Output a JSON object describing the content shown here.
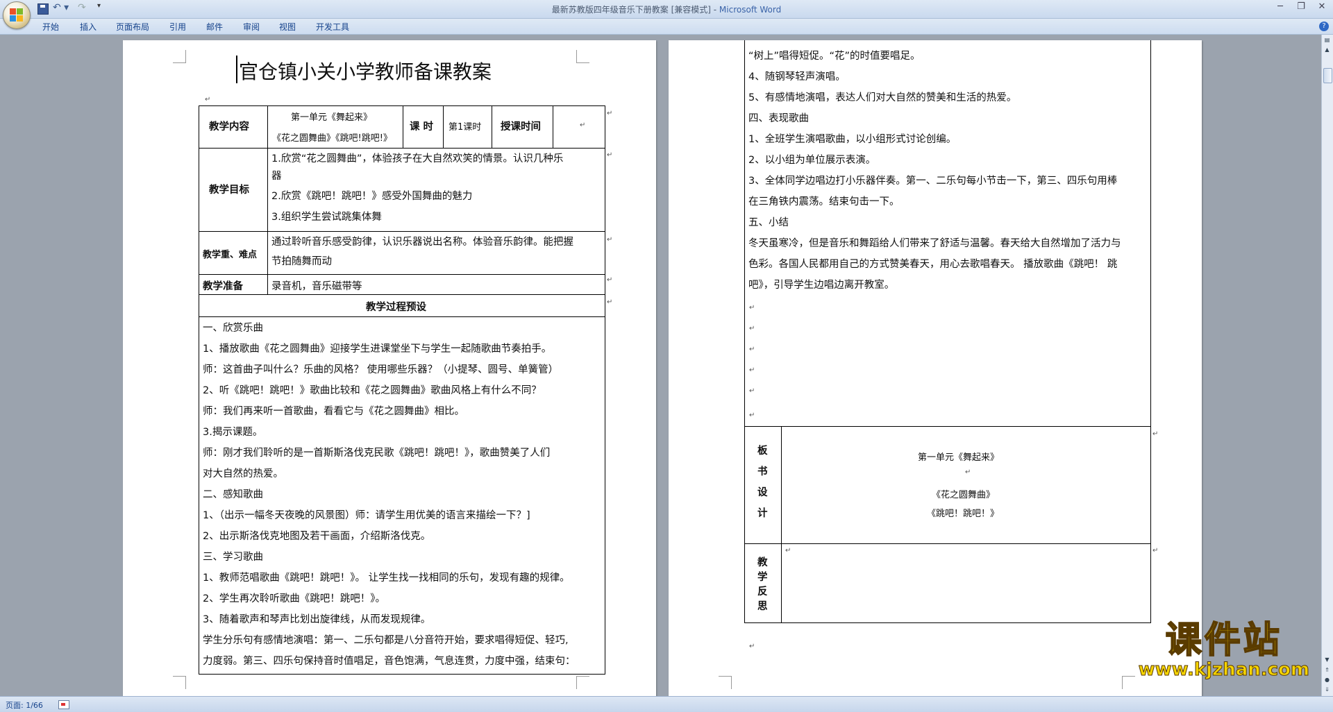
{
  "window": {
    "title": "最新苏教版四年级音乐下册教案 [兼容模式] - ",
    "app_name": "Microsoft Word",
    "qat_more": "▾",
    "minimize": "─",
    "restore": "❐",
    "close": "✕"
  },
  "ribbon": {
    "tabs": [
      "开始",
      "插入",
      "页面布局",
      "引用",
      "邮件",
      "审阅",
      "视图",
      "开发工具"
    ],
    "help": "?"
  },
  "statusbar": {
    "page": "页面: 1/66"
  },
  "page1": {
    "heading": "官仓镇小关小学教师备课教案",
    "table": {
      "content_label": "教学内容",
      "content_line1": "第一单元《舞起来》",
      "content_line2": "《花之圆舞曲》《跳吧!跳吧!》",
      "hours_label": "课 时",
      "hours_value": "第1课时",
      "time_label": "授课时间",
      "goals_label": "教学目标",
      "goals": [
        "1.欣赏“花之圆舞曲”，体验孩子在大自然欢笑的情景。认识几种乐",
        "器",
        "2.欣赏《跳吧！跳吧！》感受外国舞曲的魅力",
        "3.组织学生尝试跳集体舞"
      ],
      "key_label": "教学重、难点",
      "key": [
        "通过聆听音乐感受韵律，认识乐器说出名称。体验音乐韵律。能把握",
        "节拍随舞而动"
      ],
      "prep_label": "教学准备",
      "prep": "录音机，音乐磁带等",
      "process_title": "教学过程预设",
      "process": [
        "一、欣赏乐曲",
        "1、播放歌曲《花之圆舞曲》迎接学生进课堂坐下与学生一起随歌曲节奏拍手。",
        "      师：这首曲子叫什么？乐曲的风格？ 使用哪些乐器？（小提琴、圆号、单簧管）",
        "2、听《跳吧！跳吧！》歌曲比较和《花之圆舞曲》歌曲风格上有什么不同？",
        "      师：我们再来听一首歌曲，看看它与《花之圆舞曲》相比。",
        "3.揭示课题。",
        "      师：刚才我们聆听的是一首斯斯洛伐克民歌《跳吧！跳吧！》，歌曲赞美了人们",
        "对大自然的热爱。",
        "二、感知歌曲",
        "1、（出示一幅冬天夜晚的风景图）师：请学生用优美的语言来描绘一下？]",
        "2、出示斯洛伐克地图及若干画面，介绍斯洛伐克。",
        "三、学习歌曲",
        "1、教师范唱歌曲《跳吧！跳吧！》。 让学生找一找相同的乐句，发现有趣的规律。",
        "2、学生再次聆听歌曲《跳吧！跳吧！》。",
        "3、随着歌声和琴声比划出旋律线，从而发现规律。",
        " 学生分乐句有感情地演唱：第一、二乐句都是八分音符开始，要求唱得短促、轻巧,",
        "力度弱。第三、四乐句保持音时值唱足，音色饱满，气息连贯，力度中强，结束句："
      ]
    }
  },
  "page2": {
    "process": [
      "“树上”唱得短促。“花”的时值要唱足。",
      "4、随钢琴轻声演唱。",
      "5、有感情地演唱，表达人们对大自然的赞美和生活的热爱。",
      "四、表现歌曲",
      "1、全班学生演唱歌曲，以小组形式讨论创编。",
      "2、以小组为单位展示表演。",
      "3、全体同学边唱边打小乐器伴奏。第一、二乐句每小节击一下，第三、四乐句用棒",
      "在三角铁内震荡。结束句击一下。",
      "五、小结",
      "冬天虽寒冷，但是音乐和舞蹈给人们带来了舒适与温馨。春天给大自然增加了活力与",
      "色彩。各国人民都用自己的方式赞美春天，用心去歌唱春天。 播放歌曲《跳吧！ 跳",
      "吧》，引导学生边唱边离开教室。"
    ],
    "board_label": [
      "板",
      "书",
      "设",
      "计"
    ],
    "board_line1": "第一单元《舞起来》",
    "board_line2": "《花之圆舞曲》",
    "board_line3": "《跳吧！跳吧！》",
    "reflect_label": [
      "教",
      "学",
      "反",
      "思"
    ]
  },
  "watermark": {
    "main": "课件站",
    "url": "www.kjzhan.com"
  },
  "paragraph_mark": "↵"
}
